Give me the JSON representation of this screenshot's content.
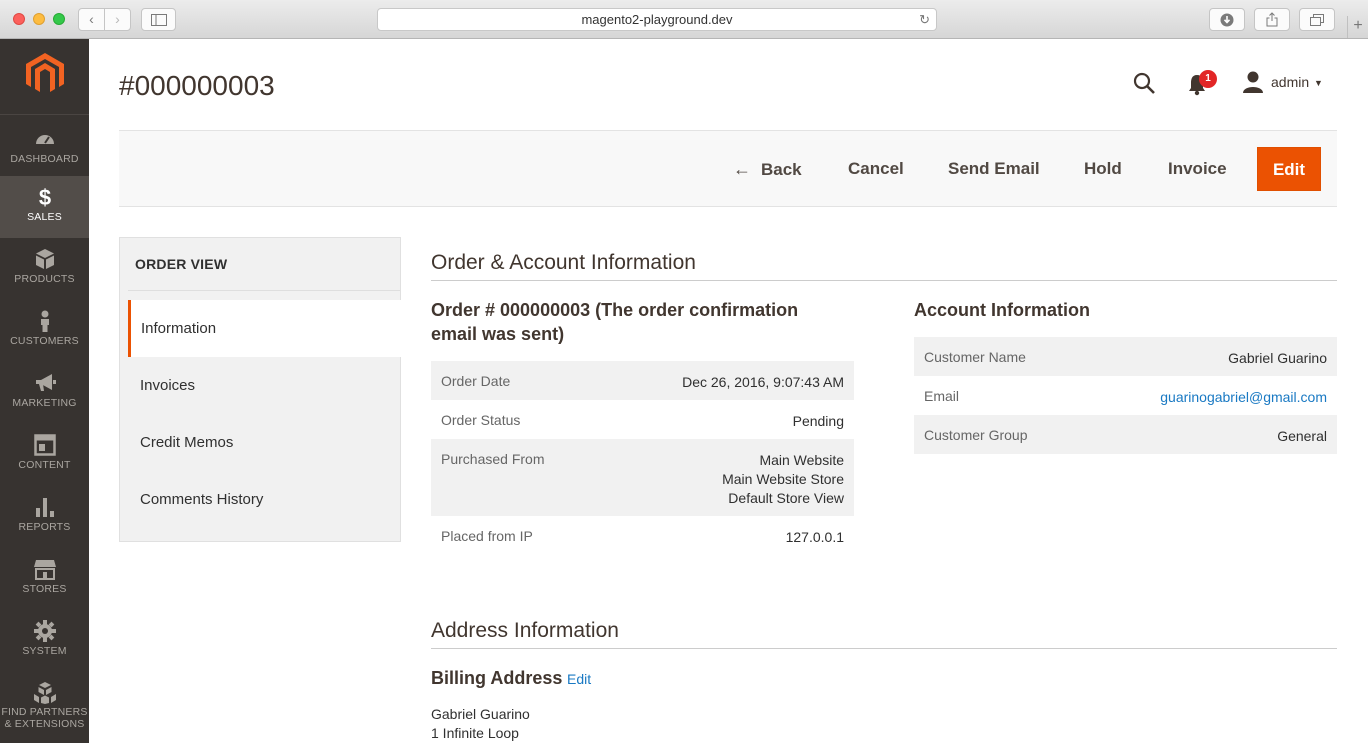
{
  "browser": {
    "url": "magento2-playground.dev",
    "nav_back": "‹",
    "nav_forward": "›",
    "reload": "↻",
    "new_tab": "+"
  },
  "menu": {
    "items": [
      {
        "label": "DASHBOARD",
        "icon": "dashboard-icon"
      },
      {
        "label": "SALES",
        "icon": "dollar-icon"
      },
      {
        "label": "PRODUCTS",
        "icon": "box-icon"
      },
      {
        "label": "CUSTOMERS",
        "icon": "person-icon"
      },
      {
        "label": "MARKETING",
        "icon": "megaphone-icon"
      },
      {
        "label": "CONTENT",
        "icon": "layout-icon"
      },
      {
        "label": "REPORTS",
        "icon": "bar-chart-icon"
      },
      {
        "label": "STORES",
        "icon": "storefront-icon"
      },
      {
        "label": "SYSTEM",
        "icon": "gear-icon"
      },
      {
        "label_line1": "FIND PARTNERS",
        "label_line2": "& EXTENSIONS",
        "icon": "cubes-icon"
      }
    ],
    "active": "SALES"
  },
  "header": {
    "title": "#000000003",
    "notification_count": "1",
    "username": "admin",
    "caret": "▼"
  },
  "actions": {
    "back_arrow": "←",
    "back": "Back",
    "cancel": "Cancel",
    "send_email": "Send Email",
    "hold": "Hold",
    "invoice": "Invoice",
    "edit": "Edit"
  },
  "side_panel": {
    "title": "ORDER VIEW",
    "tabs": [
      "Information",
      "Invoices",
      "Credit Memos",
      "Comments History"
    ],
    "active_tab": "Information"
  },
  "order_account": {
    "section_title": "Order & Account Information",
    "order_heading_line1": "Order # 000000003 (The order confirmation",
    "order_heading_line2": "email was sent)",
    "order_rows": [
      {
        "label": "Order Date",
        "value": "Dec 26, 2016, 9:07:43 AM"
      },
      {
        "label": "Order Status",
        "value": "Pending"
      },
      {
        "label": "Purchased From",
        "value_lines": [
          "Main Website",
          "Main Website Store",
          "Default Store View"
        ]
      },
      {
        "label": "Placed from IP",
        "value": "127.0.0.1"
      }
    ],
    "account_heading": "Account Information",
    "account_rows": [
      {
        "label": "Customer Name",
        "value": "Gabriel Guarino"
      },
      {
        "label": "Email",
        "value": "guarinogabriel@gmail.com"
      },
      {
        "label": "Customer Group",
        "value": "General"
      }
    ]
  },
  "address": {
    "section_title": "Address Information",
    "billing_heading": "Billing Address",
    "billing_edit": "Edit",
    "lines": [
      "Gabriel Guarino",
      "1 Infinite Loop"
    ]
  },
  "colors": {
    "accent": "#eb5202",
    "sidebar_bg": "#373330",
    "link": "#1979c3"
  }
}
